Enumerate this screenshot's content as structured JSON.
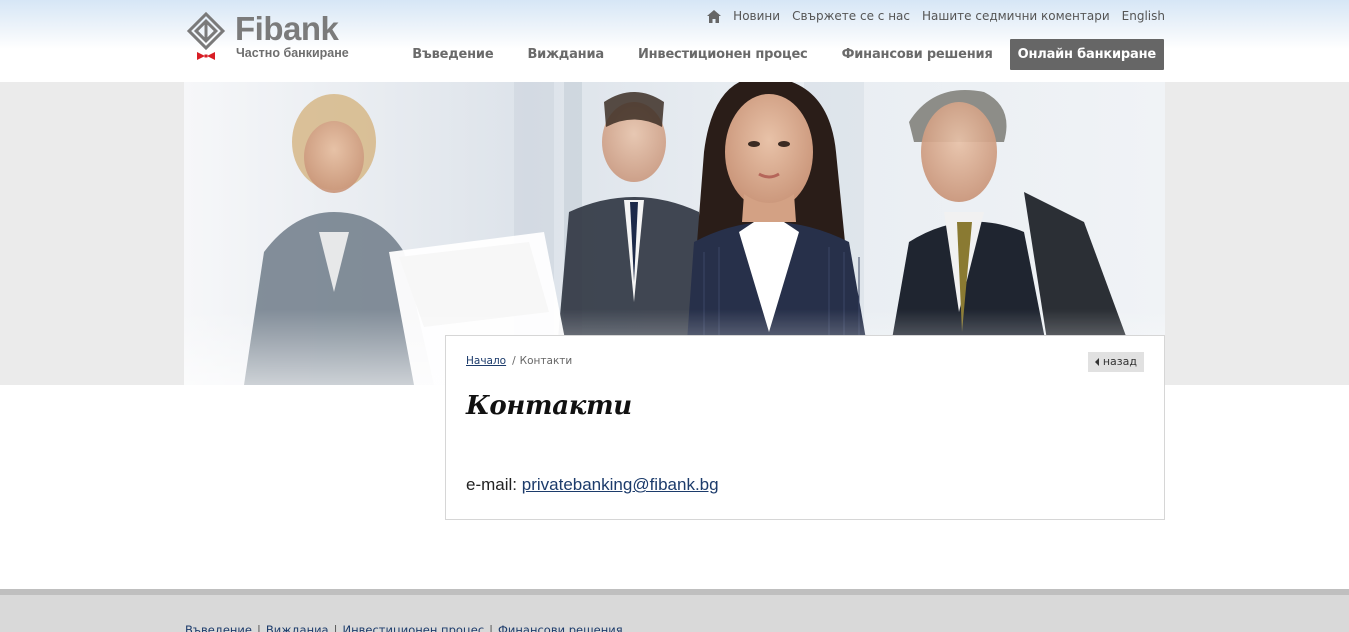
{
  "header": {
    "brand": "Fibank",
    "subtitle": "Частно банкиране",
    "top_links": [
      "Новини",
      "Свържете се с нас",
      "Нашите седмични коментари",
      "English"
    ],
    "nav": [
      "Въведение",
      "Вижданиа",
      "Инвестиционен процес",
      "Финансови решения"
    ],
    "online_banking": "Онлайн банкиране"
  },
  "breadcrumb": {
    "home": "Начало",
    "separator": "/",
    "current": "Контакти"
  },
  "back_label": "назад",
  "page_title": "Контакти",
  "contact": {
    "label": "e-mail:",
    "email": "privatebanking@fibank.bg"
  },
  "footer": {
    "links": [
      "Въведение",
      "Вижданиа",
      "Инвестиционен процес",
      "Финансови решения"
    ]
  },
  "colors": {
    "link": "#1c3b6b",
    "online_button": "#666666",
    "brand_red": "#d81e25"
  }
}
